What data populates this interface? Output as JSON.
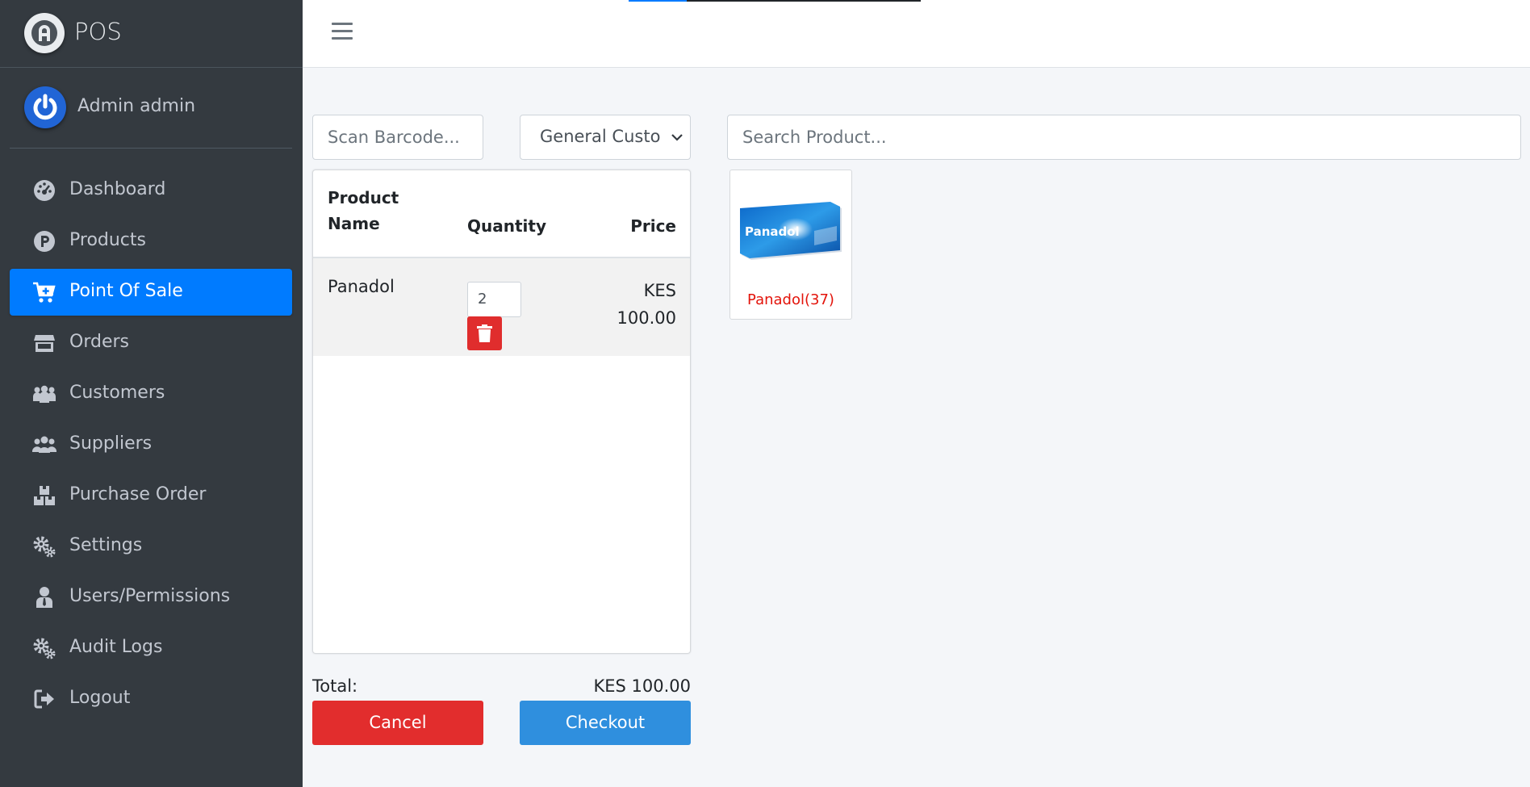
{
  "app": {
    "brand_title": "POS",
    "brand_logo_letter": "A"
  },
  "user": {
    "name": "Admin admin"
  },
  "sidebar": {
    "items": [
      {
        "label": "Dashboard",
        "icon": "dashboard-icon"
      },
      {
        "label": "Products",
        "icon": "products-icon"
      },
      {
        "label": "Point Of Sale",
        "icon": "cart-plus-icon",
        "active": true
      },
      {
        "label": "Orders",
        "icon": "store-icon"
      },
      {
        "label": "Customers",
        "icon": "customers-icon"
      },
      {
        "label": "Suppliers",
        "icon": "suppliers-icon"
      },
      {
        "label": "Purchase Order",
        "icon": "boxes-icon"
      },
      {
        "label": "Settings",
        "icon": "cogs-icon"
      },
      {
        "label": "Users/Permissions",
        "icon": "user-tie-icon"
      },
      {
        "label": "Audit Logs",
        "icon": "cogs-icon"
      },
      {
        "label": "Logout",
        "icon": "sign-out-icon"
      }
    ]
  },
  "pos": {
    "barcode_placeholder": "Scan Barcode...",
    "customer_select": {
      "value": "General Customer"
    },
    "search_placeholder": "Search Product...",
    "cart": {
      "headers": {
        "product_line1": "Product",
        "product_line2": "Name",
        "quantity": "Quantity",
        "price": "Price"
      },
      "rows": [
        {
          "name": "Panadol",
          "quantity": "2",
          "price_currency": "KES",
          "price_amount": "100.00"
        }
      ]
    },
    "total_label": "Total:",
    "total_value": "KES 100.00",
    "cancel_label": "Cancel",
    "checkout_label": "Checkout",
    "products": [
      {
        "name": "Panadol(37)",
        "image_text": "Panadol"
      }
    ]
  },
  "colors": {
    "sidebar_bg": "#343a40",
    "active": "#007bff",
    "danger": "#e22d2d",
    "checkout": "#2f8fde",
    "product_name": "#e3140b"
  }
}
